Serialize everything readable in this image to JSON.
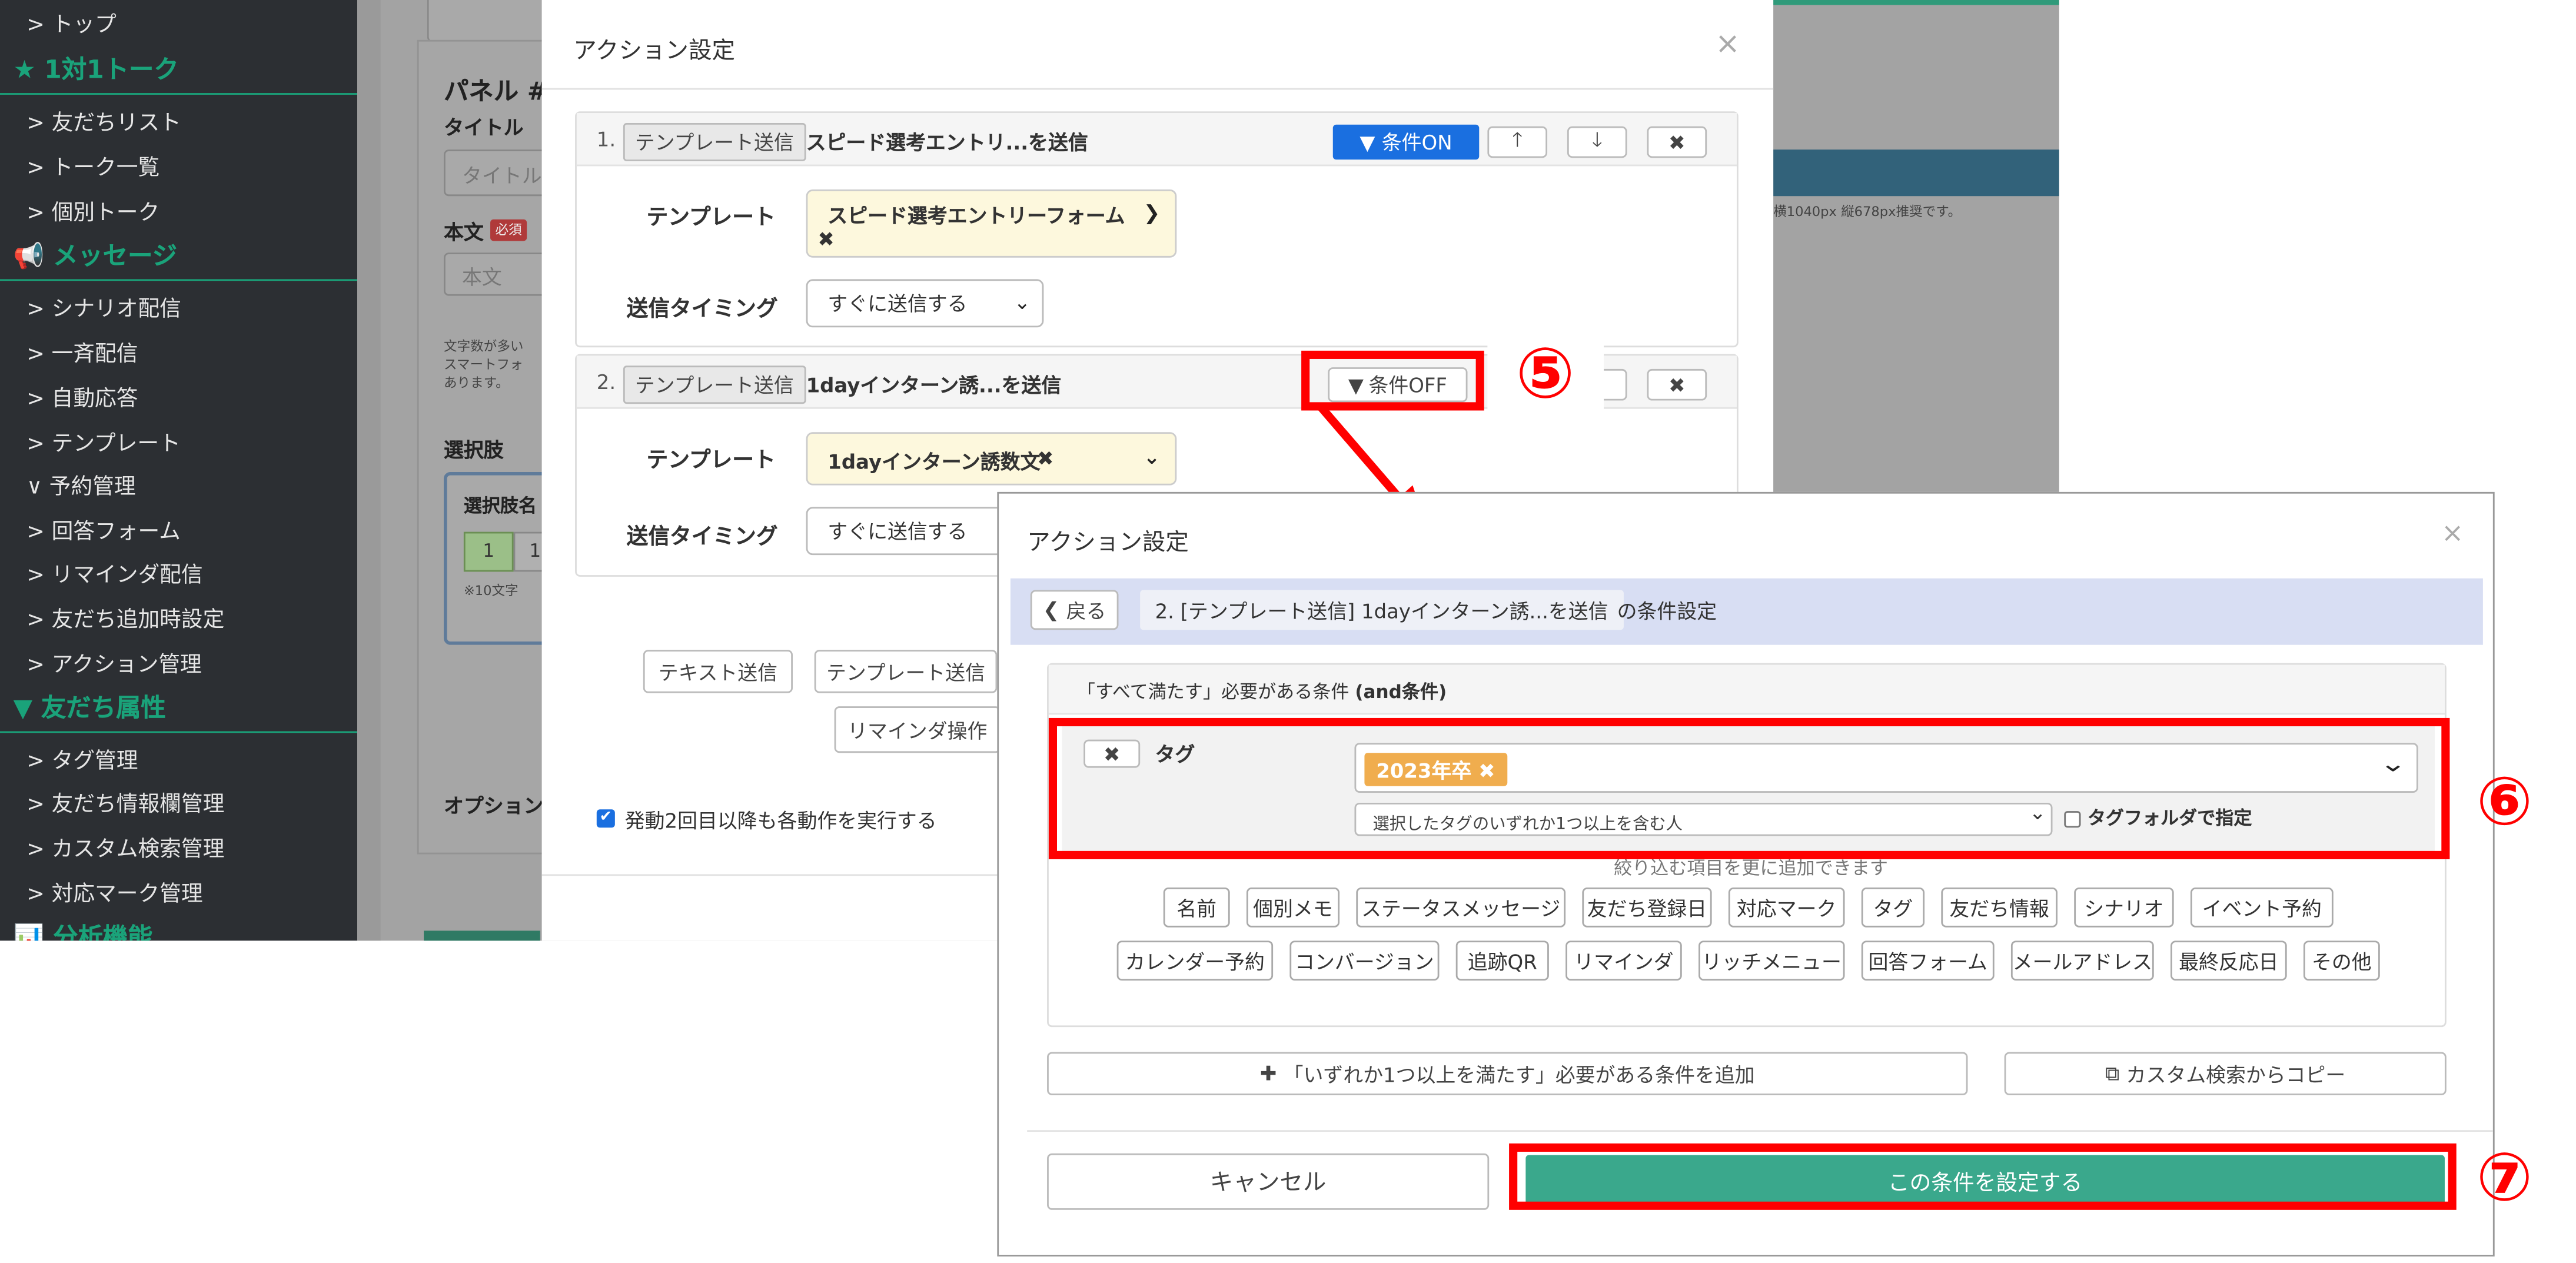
{
  "sidebar": {
    "items": [
      {
        "label": "> トップ",
        "kind": "item"
      },
      {
        "label": "★ 1対1トーク",
        "kind": "section"
      },
      {
        "label": "> 友だちリスト",
        "kind": "item"
      },
      {
        "label": "> トーク一覧",
        "kind": "item"
      },
      {
        "label": "> 個別トーク",
        "kind": "item"
      },
      {
        "label": "📢 メッセージ",
        "kind": "section"
      },
      {
        "label": "> シナリオ配信",
        "kind": "item"
      },
      {
        "label": "> 一斉配信",
        "kind": "item"
      },
      {
        "label": "> 自動応答",
        "kind": "item"
      },
      {
        "label": "> テンプレート",
        "kind": "item"
      },
      {
        "label": "∨ 予約管理",
        "kind": "item"
      },
      {
        "label": "> 回答フォーム",
        "kind": "item"
      },
      {
        "label": "> リマインダ配信",
        "kind": "item"
      },
      {
        "label": "> 友だち追加時設定",
        "kind": "item"
      },
      {
        "label": "> アクション管理",
        "kind": "item"
      },
      {
        "label": "▼ 友だち属性",
        "kind": "section"
      },
      {
        "label": "> タグ管理",
        "kind": "item"
      },
      {
        "label": "> 友だち情報欄管理",
        "kind": "item"
      },
      {
        "label": "> カスタム検索管理",
        "kind": "item"
      },
      {
        "label": "> 対応マーク管理",
        "kind": "item"
      },
      {
        "label": "📊 分析機能",
        "kind": "section"
      }
    ]
  },
  "background": {
    "panel_title": "パネル #",
    "title_label": "タイトル",
    "title_placeholder": "タイトル",
    "body_label": "本文",
    "required_badge": "必須",
    "body_placeholder": "本文",
    "note": "文字数が多い\nスマートフォ\nあります。",
    "choices_label": "選択肢",
    "choice_name_label": "選択肢名",
    "choice_tab1": "1",
    "choice_tab2": "1",
    "char_note": "※10文字",
    "option_label": "オプション",
    "right_note": "横1040px 縦678px推奨です。"
  },
  "modal1": {
    "title": "アクション設定",
    "close": "×",
    "action1": {
      "num": "1.",
      "type": "テンプレート送信",
      "desc": "スピード選考エントリ...を送信",
      "cond_button": "条件ON",
      "template_label": "テンプレート",
      "template_value": "スピード選考エントリーフォーム",
      "timing_label": "送信タイミング",
      "timing_value": "すぐに送信する"
    },
    "action2": {
      "num": "2.",
      "type": "テンプレート送信",
      "desc": "1dayインターン誘...を送信",
      "cond_button": "条件OFF",
      "template_label": "テンプレート",
      "template_value": "1dayインターン誘数文",
      "timing_label": "送信タイミング",
      "timing_value": "すぐに送信する"
    },
    "add_text": "テキスト送信",
    "add_template": "テンプレート送信",
    "add_reminder": "リマインダ操作",
    "repeat_check": "発動2回目以降も各動作を実行する"
  },
  "modal2": {
    "title": "アクション設定",
    "close": "×",
    "back": "戻る",
    "target": "2. [テンプレート送信] 1dayインターン誘...を送信",
    "target_suffix": "の条件設定",
    "and_header_a": "「すべて満たす」必要がある条件",
    "and_header_b": "(and条件)",
    "remove": "✖",
    "cond_type": "タグ",
    "tag_chip": "2023年卒",
    "match_mode": "選択したタグのいずれか1つ以上を含む人",
    "folder_check": "タグフォルダで指定",
    "hint": "絞り込む項目を更に追加できます",
    "buttons_row1": [
      "名前",
      "個別メモ",
      "ステータスメッセージ",
      "友だち登録日",
      "対応マーク",
      "タグ",
      "友だち情報",
      "シナリオ",
      "イベント予約"
    ],
    "buttons_row2": [
      "カレンダー予約",
      "コンバージョン",
      "追跡QR",
      "リマインダ",
      "リッチメニュー",
      "回答フォーム",
      "メールアドレス",
      "最終反応日",
      "その他"
    ],
    "or_add": "「いずれか1つ以上を満たす」必要がある条件を追加",
    "copy_custom": "カスタム検索からコピー",
    "cancel": "キャンセル",
    "submit": "この条件を設定する"
  },
  "annotations": {
    "n5": "⑤",
    "n6": "⑥",
    "n7": "⑦"
  },
  "colors": {
    "accent": "#3aa88c",
    "sidebar": "#2c2f33",
    "sidebar_section": "#1aa37a",
    "cond_on": "#1a6fe0",
    "annotation": "#ff0000",
    "tag_chip": "#f0ad4e",
    "panel_header": "#d8def3"
  }
}
